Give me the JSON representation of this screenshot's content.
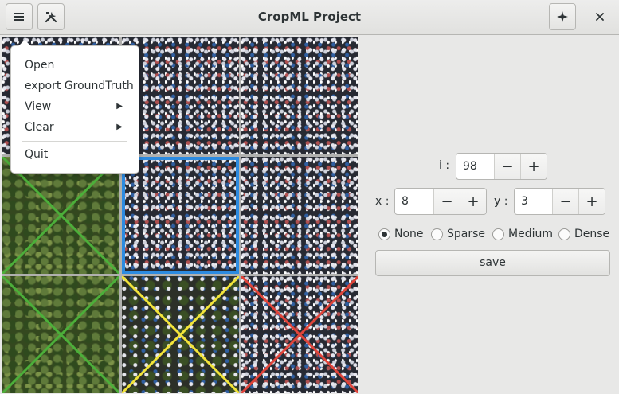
{
  "window": {
    "title": "CropML Project"
  },
  "header": {
    "menu_icon": "hamburger-icon",
    "tools_icon": "tools-icon",
    "star_icon": "sparkle-icon",
    "close_icon": "close-icon"
  },
  "menu": {
    "items": [
      {
        "label": "Open",
        "has_submenu": false
      },
      {
        "label": "export GroundTruth",
        "has_submenu": false
      },
      {
        "label": "View",
        "has_submenu": true
      },
      {
        "label": "Clear",
        "has_submenu": true
      },
      {
        "label": "Quit",
        "has_submenu": false
      }
    ],
    "submenu_glyph": "▶"
  },
  "grid": {
    "rows": 3,
    "cols": 3,
    "cells": [
      {
        "texture": "crowd",
        "mark": "none",
        "selected": false
      },
      {
        "texture": "crowd",
        "mark": "none",
        "selected": false
      },
      {
        "texture": "crowd",
        "mark": "none",
        "selected": false
      },
      {
        "texture": "trees",
        "mark": "cross",
        "color": "#4caf3a",
        "selected": false
      },
      {
        "texture": "crowd",
        "mark": "none",
        "selected": true
      },
      {
        "texture": "crowd",
        "mark": "none",
        "selected": false
      },
      {
        "texture": "trees",
        "mark": "cross",
        "color": "#4caf3a",
        "selected": false
      },
      {
        "texture": "mix",
        "mark": "cross",
        "color": "#f2e43a",
        "selected": false
      },
      {
        "texture": "crowd",
        "mark": "cross",
        "color": "#e0443a",
        "selected": false
      }
    ],
    "selected_color": "#2d8be0"
  },
  "panel": {
    "i": {
      "label": "i :",
      "value": "98"
    },
    "x": {
      "label": "x :",
      "value": "8"
    },
    "y": {
      "label": "y :",
      "value": "3"
    },
    "minus": "−",
    "plus": "+",
    "density": {
      "options": [
        "None",
        "Sparse",
        "Medium",
        "Dense"
      ],
      "selected": "None"
    },
    "save_label": "save"
  }
}
